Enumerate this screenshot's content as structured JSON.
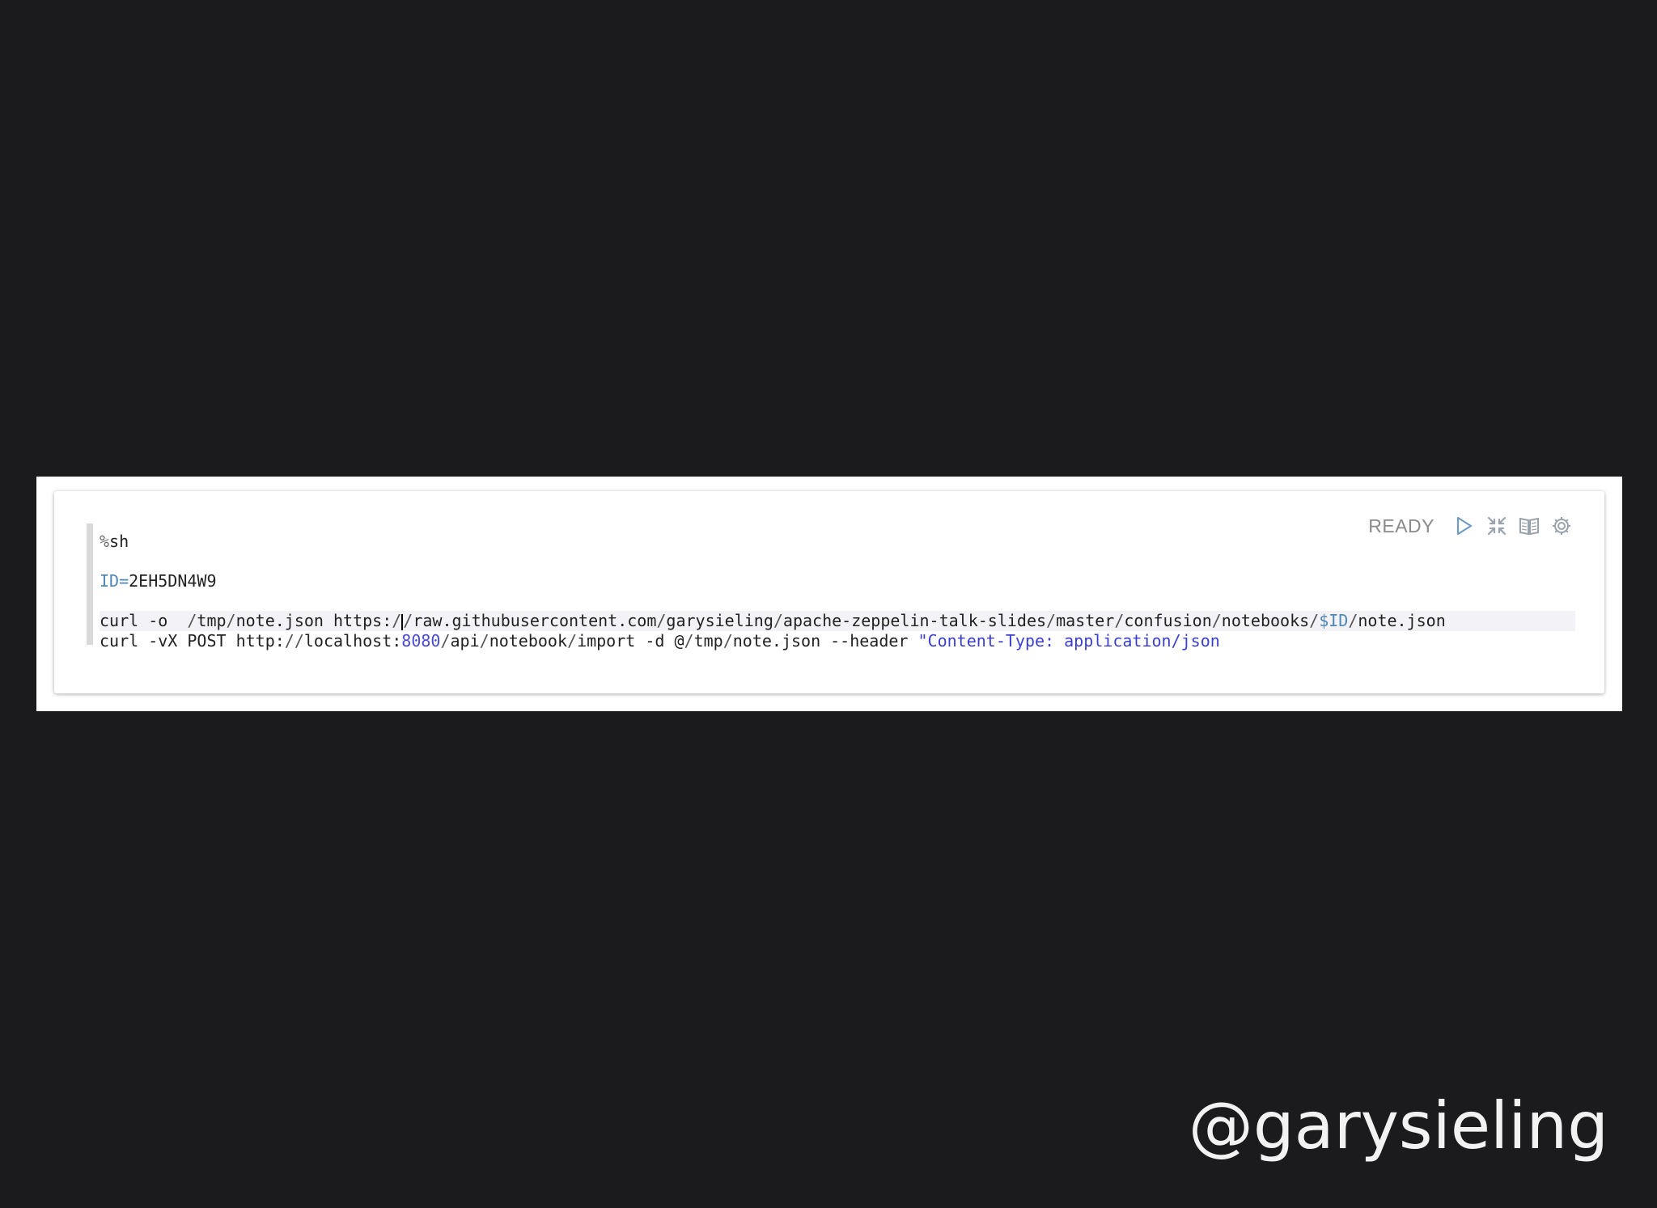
{
  "paragraph": {
    "status": "READY",
    "lines": [
      {
        "tokens": [
          {
            "t": "%",
            "c": "tok-kw"
          },
          {
            "t": "sh",
            "c": ""
          }
        ]
      },
      {
        "tokens": [
          {
            "t": "ID=",
            "c": "tok-var"
          },
          {
            "t": "2EH5DN4W9",
            "c": ""
          }
        ]
      },
      {
        "active": true,
        "tokens": [
          {
            "t": "curl -o  ",
            "c": ""
          },
          {
            "t": "/",
            "c": "tok-op"
          },
          {
            "t": "tmp",
            "c": ""
          },
          {
            "t": "/",
            "c": "tok-op"
          },
          {
            "t": "note.json https:",
            "c": ""
          },
          {
            "t": "/",
            "c": "tok-op"
          },
          {
            "t": "|CURSOR|",
            "c": "cursor"
          },
          {
            "t": "/",
            "c": "tok-op"
          },
          {
            "t": "raw.githubusercontent.com",
            "c": ""
          },
          {
            "t": "/",
            "c": "tok-op"
          },
          {
            "t": "garysieling",
            "c": ""
          },
          {
            "t": "/",
            "c": "tok-op"
          },
          {
            "t": "apache-zeppelin-talk-slides",
            "c": ""
          },
          {
            "t": "/",
            "c": "tok-op"
          },
          {
            "t": "master",
            "c": ""
          },
          {
            "t": "/",
            "c": "tok-op"
          },
          {
            "t": "confusion",
            "c": ""
          },
          {
            "t": "/",
            "c": "tok-op"
          },
          {
            "t": "notebooks",
            "c": ""
          },
          {
            "t": "/",
            "c": "tok-op"
          },
          {
            "t": "$ID",
            "c": "tok-var"
          },
          {
            "t": "/",
            "c": "tok-op"
          },
          {
            "t": "note.json",
            "c": ""
          }
        ]
      },
      {
        "tokens": [
          {
            "t": "curl -vX POST http:",
            "c": ""
          },
          {
            "t": "//",
            "c": "tok-op"
          },
          {
            "t": "localhost:",
            "c": ""
          },
          {
            "t": "8080",
            "c": "tok-num"
          },
          {
            "t": "/",
            "c": "tok-op"
          },
          {
            "t": "api",
            "c": ""
          },
          {
            "t": "/",
            "c": "tok-op"
          },
          {
            "t": "notebook",
            "c": ""
          },
          {
            "t": "/",
            "c": "tok-op"
          },
          {
            "t": "import -d @",
            "c": ""
          },
          {
            "t": "/",
            "c": "tok-op"
          },
          {
            "t": "tmp",
            "c": ""
          },
          {
            "t": "/",
            "c": "tok-op"
          },
          {
            "t": "note.json --header ",
            "c": ""
          },
          {
            "t": "\"Content-Type: application/json",
            "c": "tok-str"
          }
        ]
      }
    ],
    "icons": [
      "run-icon",
      "collapse-icon",
      "book-icon",
      "gear-icon"
    ]
  },
  "watermark": "@garysieling",
  "colors": {
    "background": "#1b1a1c",
    "status": "#8a8a8a",
    "icon": "#9aa3ad"
  }
}
